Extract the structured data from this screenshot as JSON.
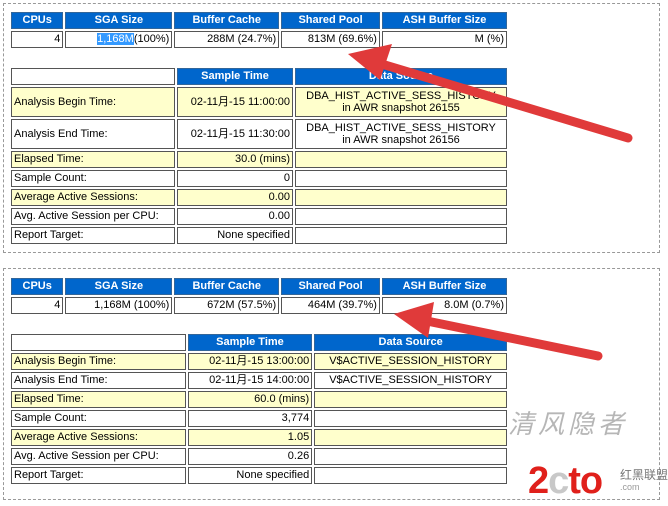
{
  "report1": {
    "summary_headers": [
      "CPUs",
      "SGA Size",
      "Buffer Cache",
      "Shared Pool",
      "ASH Buffer Size"
    ],
    "summary_values": {
      "cpus": "4",
      "sga_highlight": "1,168M",
      "sga_rest": "(100%)",
      "buffer_cache": "288M (24.7%)",
      "shared_pool": "813M (69.6%)",
      "ash_buffer": "M (%)"
    },
    "detail_headers": [
      "Sample Time",
      "Data Source"
    ],
    "rows": {
      "begin_label": "Analysis Begin Time:",
      "begin_time": "02-11月-15 11:00:00",
      "begin_source_1": "DBA_HIST_ACTIVE_SESS_HISTORY",
      "begin_source_2": "in AWR snapshot 26155",
      "end_label": "Analysis End Time:",
      "end_time": "02-11月-15 11:30:00",
      "end_source_1": "DBA_HIST_ACTIVE_SESS_HISTORY",
      "end_source_2": "in AWR snapshot 26156",
      "elapsed_label": "Elapsed Time:",
      "elapsed_value": "30.0 (mins)",
      "sample_label": "Sample Count:",
      "sample_value": "0",
      "avg_label": "Average Active Sessions:",
      "avg_value": "0.00",
      "avg_cpu_label": "Avg. Active Session per CPU:",
      "avg_cpu_value": "0.00",
      "target_label": "Report Target:",
      "target_value": "None specified"
    }
  },
  "report2": {
    "summary_headers": [
      "CPUs",
      "SGA Size",
      "Buffer Cache",
      "Shared Pool",
      "ASH Buffer Size"
    ],
    "summary_values": {
      "cpus": "4",
      "sga": "1,168M (100%)",
      "buffer_cache": "672M (57.5%)",
      "shared_pool": "464M (39.7%)",
      "ash_buffer": "8.0M (0.7%)"
    },
    "detail_headers": [
      "Sample Time",
      "Data Source"
    ],
    "rows": {
      "begin_label": "Analysis Begin Time:",
      "begin_time": "02-11月-15 13:00:00",
      "begin_source": "V$ACTIVE_SESSION_HISTORY",
      "end_label": "Analysis End Time:",
      "end_time": "02-11月-15 14:00:00",
      "end_source": "V$ACTIVE_SESSION_HISTORY",
      "elapsed_label": "Elapsed Time:",
      "elapsed_value": "60.0 (mins)",
      "sample_label": "Sample Count:",
      "sample_value": "3,774",
      "avg_label": "Average Active Sessions:",
      "avg_value": "1.05",
      "avg_cpu_label": "Avg. Active Session per CPU:",
      "avg_cpu_value": "0.26",
      "target_label": "Report Target:",
      "target_value": "None specified"
    }
  },
  "watermark": {
    "cn_text": "清风隐者",
    "logo_left": "2",
    "logo_mid": "c",
    "logo_right": "to",
    "logo_suffix": ".com",
    "sub_text": "红黑联盟"
  },
  "colors": {
    "header_bg": "#0066cc",
    "highlight_bg": "#ffffcc",
    "arrow": "#e03a3a"
  }
}
